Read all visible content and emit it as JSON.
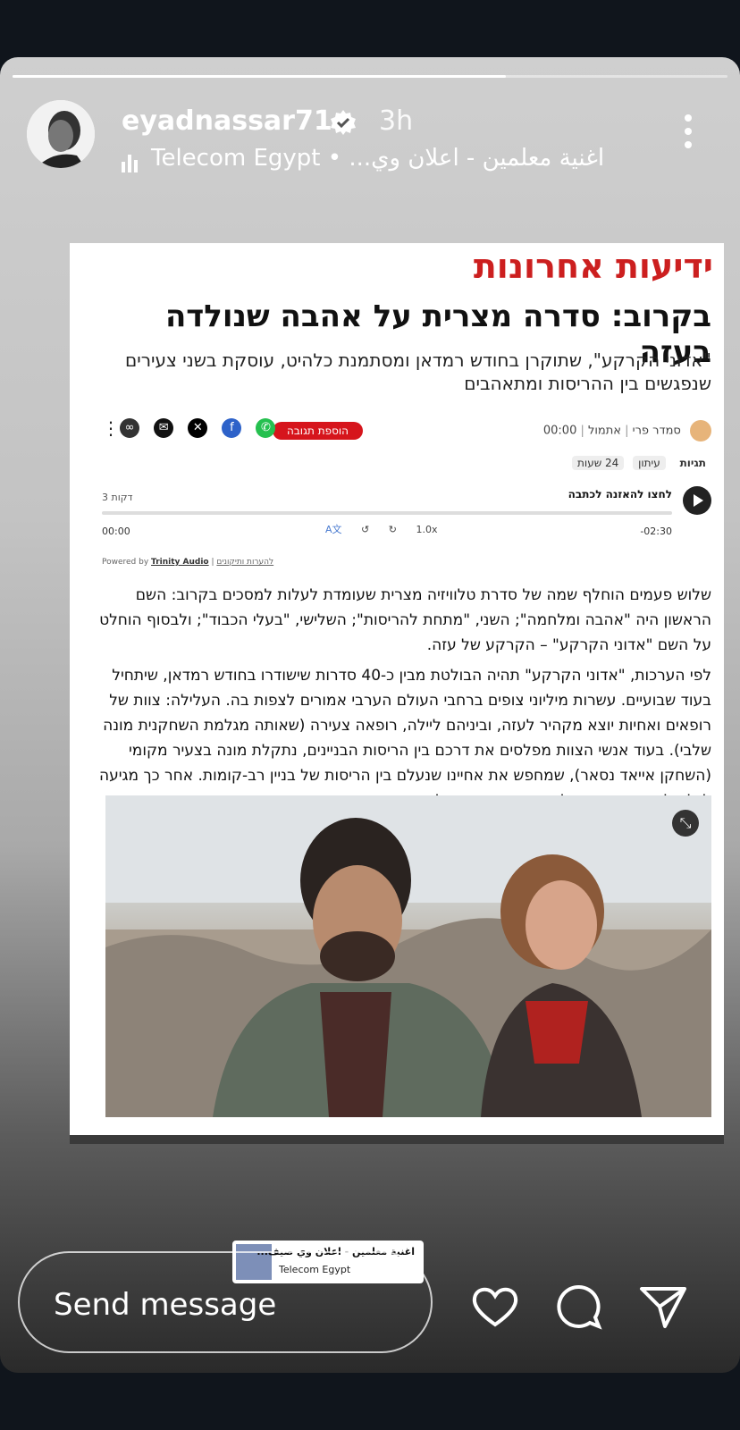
{
  "story": {
    "username": "eyadnassar71",
    "time": "3h",
    "music": "Telecom Egypt • ...اغنية معلمين - اعلان وي",
    "progress": 0.69
  },
  "article": {
    "publication": "ידיעות אחרונות",
    "headline": "בקרוב: סדרה מצרית על אהבה שנולדה בעזה",
    "subheadline": "\"אדוני הקרקע\", שתוקרן בחודש רמדאן ומסתמנת כלהיט, עוסקת בשני צעירים שנפגשים בין ההריסות ומתאהבים",
    "author": "סמדר פרי",
    "date": "אתמול",
    "time": "00:00",
    "add_comment": "הוספת תגובה",
    "tags": [
      "תגיות",
      "עיתון",
      "24 שעות"
    ],
    "audio": {
      "listen": "לחצו להאזנה לכתבה",
      "duration": "3 דקות",
      "start": "00:00",
      "end": "-02:30",
      "speed": "1.0x",
      "powered_by": "Powered by",
      "provider": "Trinity Audio",
      "feedback": "להערות ותיקונים"
    },
    "paragraph1": "שלוש פעמים הוחלף שמה של סדרת טלוויזיה מצרית שעומדת לעלות למסכים בקרוב: השם הראשון היה \"אהבה ומלחמה\"; השני, \"מתחת להריסות\"; השלישי, \"בעלי הכבוד\"; ולבסוף הוחלט על השם \"אדוני הקרקע\" – הקרקע של עזה.",
    "paragraph2": "לפי הערכות, \"אדוני הקרקע\" תהיה הבולטת מבין כ-40 סדרות שישודרו בחודש רמדאן, שיתחיל בעוד שבועיים. עשרות מיליוני צופים ברחבי העולם הערבי אמורים לצפות בה. העלילה: צוות של רופאים ואחיות יוצא מקהיר לעזה, וביניהם ליילה, רופאה צעירה (שאותה מגלמת השחקנית מונה שלבי). בעוד אנשי הצוות מפלסים את דרכם בין הריסות הבניינים, נתקלת מונה בצעיר מקומי (השחקן אייאד נסאר), שמחפש את אחיינו שנעלם בין הריסות של בניין רב-קומות. אחר כך מגיעה ליילה לאחד מבתי החולים המקומיים ונתקלת בו שוב. מכאן מתפתח סיפור אהבה סוער."
  },
  "sticker": {
    "title": "اغنية معلمين - اعلان وي صيف...",
    "artist": "Telecom Egypt"
  },
  "reply": {
    "placeholder": "Send message"
  },
  "colors": {
    "brand_red": "#cc1f1f",
    "verified_blue": "#ffffff"
  }
}
